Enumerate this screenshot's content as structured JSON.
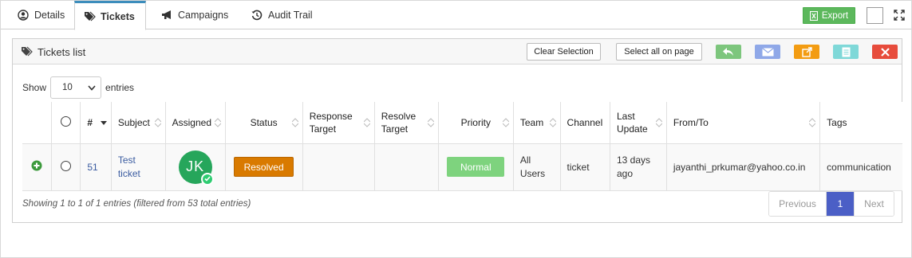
{
  "tabs": [
    {
      "label": "Details",
      "icon": "user-circle-icon"
    },
    {
      "label": "Tickets",
      "icon": "tags-icon"
    },
    {
      "label": "Campaigns",
      "icon": "bullhorn-icon"
    },
    {
      "label": "Audit Trail",
      "icon": "history-icon"
    }
  ],
  "toolbar": {
    "export_label": "Export"
  },
  "panel": {
    "title": "Tickets list",
    "clear_selection": "Clear Selection",
    "select_all": "Select all on page"
  },
  "length": {
    "show": "Show",
    "value": "10",
    "entries": "entries"
  },
  "table": {
    "headers": {
      "num": "#",
      "subject": "Subject",
      "assigned": "Assigned",
      "status": "Status",
      "response_target": "Response Target",
      "resolve_target": "Resolve Target",
      "priority": "Priority",
      "team": "Team",
      "channel": "Channel",
      "last_update": "Last Update",
      "from_to": "From/To",
      "tags": "Tags"
    },
    "rows": [
      {
        "num": "51",
        "subject": "Test ticket",
        "assigned_initials": "JK",
        "status": "Resolved",
        "response_target": "",
        "resolve_target": "",
        "priority": "Normal",
        "team": "All Users",
        "channel": "ticket",
        "last_update": "13 days ago",
        "from_to": "jayanthi_prkumar@yahoo.co.in",
        "tags": "communication"
      }
    ]
  },
  "info": "Showing 1 to 1 of 1 entries (filtered from 53 total entries)",
  "pagination": {
    "previous": "Previous",
    "current": "1",
    "next": "Next"
  },
  "colors": {
    "export": "#5cb85c",
    "reply": "#7dc67d",
    "email": "#8fa8e8",
    "forward": "#f39c12",
    "note": "#7fd8d8",
    "delete": "#e74c3c",
    "status_resolved": "#d97a00",
    "priority_normal": "#7ed37e",
    "pagination_active": "#4b5fc6"
  }
}
